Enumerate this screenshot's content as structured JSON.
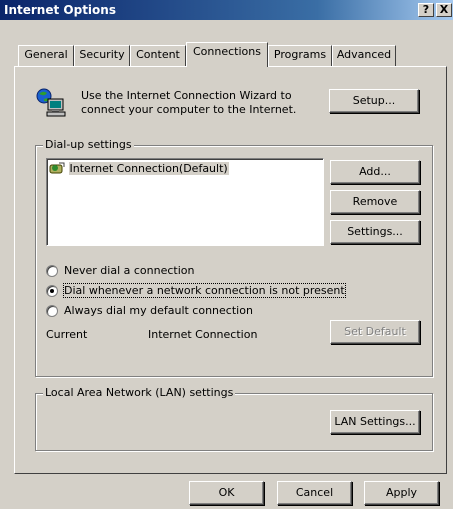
{
  "window": {
    "title": "Internet Options",
    "help_button": "?",
    "close_button": "X"
  },
  "tabs": [
    {
      "label": "General"
    },
    {
      "label": "Security"
    },
    {
      "label": "Content"
    },
    {
      "label": "Connections",
      "active": true
    },
    {
      "label": "Programs"
    },
    {
      "label": "Advanced"
    }
  ],
  "wizard": {
    "text_line1": "Use the Internet Connection Wizard to",
    "text_line2": "connect your computer to the Internet.",
    "setup_button": "Setup..."
  },
  "dialup": {
    "group_label": "Dial-up settings",
    "connections": [
      {
        "name": "Internet Connection(Default)",
        "selected": true
      }
    ],
    "add_button": "Add...",
    "remove_button": "Remove",
    "settings_button": "Settings...",
    "options": [
      {
        "label": "Never dial a connection",
        "checked": false
      },
      {
        "label": "Dial whenever a network connection is not present",
        "checked": true
      },
      {
        "label": "Always dial my default connection",
        "checked": false
      }
    ],
    "current_label": "Current",
    "current_value": "Internet Connection",
    "set_default_button": "Set Default"
  },
  "lan": {
    "group_label": "Local Area Network (LAN) settings",
    "lan_settings_button": "LAN Settings..."
  },
  "footer": {
    "ok_button": "OK",
    "cancel_button": "Cancel",
    "apply_button": "Apply"
  }
}
